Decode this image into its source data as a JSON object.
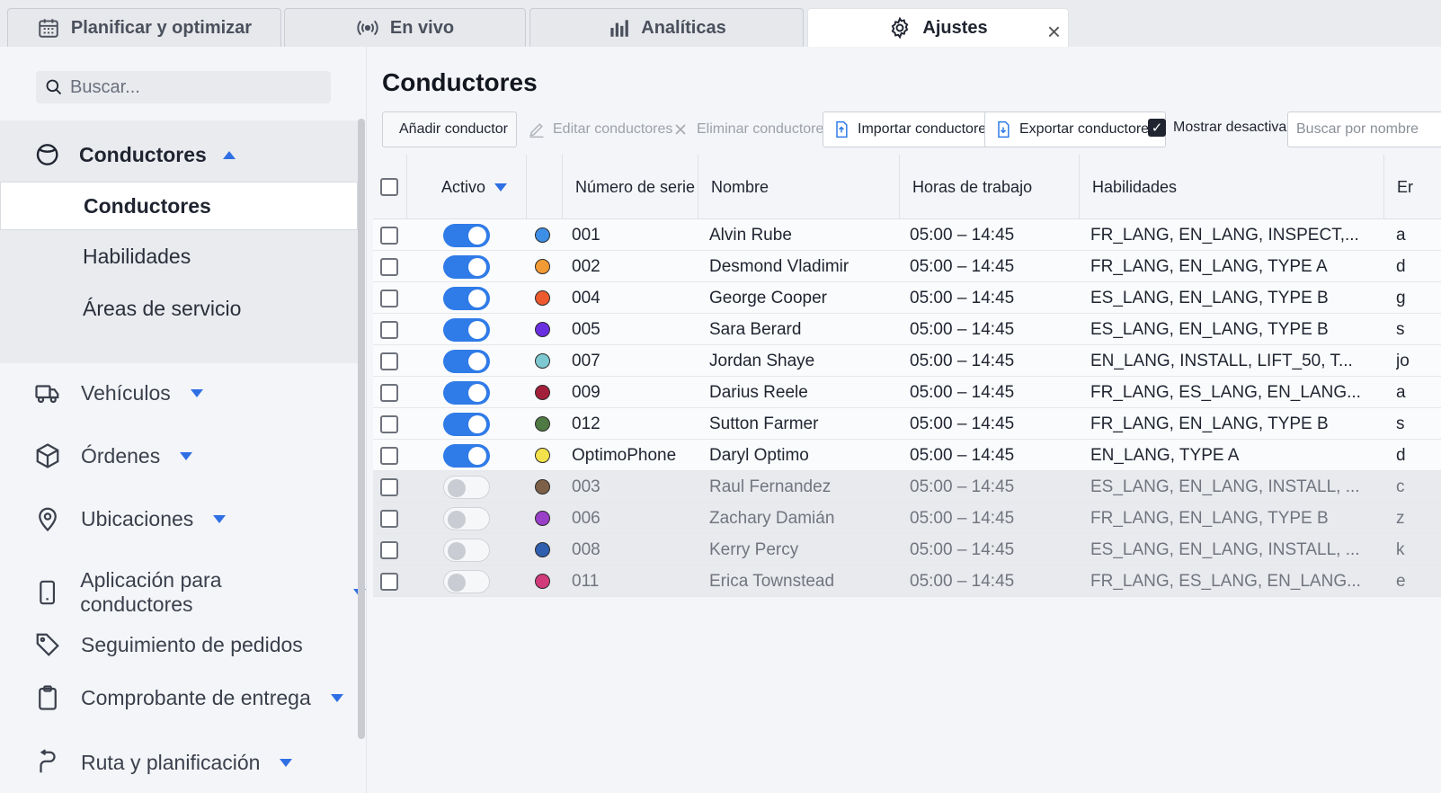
{
  "tabs": [
    {
      "label": "Planificar y optimizar",
      "icon": "calendar-icon"
    },
    {
      "label": "En vivo",
      "icon": "broadcast-icon"
    },
    {
      "label": "Analíticas",
      "icon": "bar-chart-icon"
    },
    {
      "label": "Ajustes",
      "icon": "gear-icon",
      "active": true,
      "close": "×"
    }
  ],
  "sidebar": {
    "search_placeholder": "Buscar...",
    "drivers_header": "Conductores",
    "sub_items": [
      "Conductores",
      "Habilidades",
      "Áreas de servicio"
    ],
    "items": [
      {
        "label": "Vehículos",
        "icon": "truck-icon"
      },
      {
        "label": "Órdenes",
        "icon": "box-icon"
      },
      {
        "label": "Ubicaciones",
        "icon": "location-pin-icon"
      },
      {
        "label": "Aplicación para conductores",
        "icon": "phone-icon"
      },
      {
        "label": "Seguimiento de pedidos",
        "icon": "tag-icon"
      },
      {
        "label": "Comprobante de entrega",
        "icon": "clipboard-icon"
      },
      {
        "label": "Ruta y planificación",
        "icon": "route-icon"
      }
    ]
  },
  "main": {
    "title": "Conductores",
    "toolbar": {
      "add": "Añadir conductor",
      "edit": "Editar conductores",
      "delete": "Eliminar conductores",
      "import": "Importar conductores",
      "export": "Exportar conductores",
      "show_inactive": "Mostrar desactivados",
      "name_search_placeholder": "Buscar por nombre"
    },
    "columns": [
      "Activo",
      "Número de serie",
      "Nombre",
      "Horas de trabajo",
      "Habilidades",
      "Er"
    ],
    "rows": [
      {
        "active": true,
        "color": "#3d8ee6",
        "serial": "001",
        "name": "Alvin Rube",
        "hours": "05:00 – 14:45",
        "skills": "FR_LANG, EN_LANG, INSPECT,...",
        "extra": "a"
      },
      {
        "active": true,
        "color": "#f29a34",
        "serial": "002",
        "name": "Desmond Vladimir",
        "hours": "05:00 – 14:45",
        "skills": "FR_LANG, EN_LANG, TYPE A",
        "extra": "d"
      },
      {
        "active": true,
        "color": "#ec5a2e",
        "serial": "004",
        "name": "George Cooper",
        "hours": "05:00 – 14:45",
        "skills": "ES_LANG, EN_LANG, TYPE B",
        "extra": "g"
      },
      {
        "active": true,
        "color": "#6a2fe0",
        "serial": "005",
        "name": "Sara Berard",
        "hours": "05:00 – 14:45",
        "skills": "ES_LANG, EN_LANG, TYPE B",
        "extra": "s"
      },
      {
        "active": true,
        "color": "#7ec9d1",
        "serial": "007",
        "name": "Jordan Shaye",
        "hours": "05:00 – 14:45",
        "skills": "EN_LANG, INSTALL, LIFT_50, T...",
        "extra": "jo"
      },
      {
        "active": true,
        "color": "#a3203a",
        "serial": "009",
        "name": "Darius Reele",
        "hours": "05:00 – 14:45",
        "skills": "FR_LANG, ES_LANG, EN_LANG...",
        "extra": "a"
      },
      {
        "active": true,
        "color": "#4f7a43",
        "serial": "012",
        "name": "Sutton Farmer",
        "hours": "05:00 – 14:45",
        "skills": "FR_LANG, EN_LANG, TYPE B",
        "extra": "s"
      },
      {
        "active": true,
        "color": "#f2e14a",
        "serial": "OptimoPhone",
        "name": "Daryl Optimo",
        "hours": "05:00 – 14:45",
        "skills": "EN_LANG, TYPE A",
        "extra": "d"
      },
      {
        "active": false,
        "color": "#7d6047",
        "serial": "003",
        "name": "Raul Fernandez",
        "hours": "05:00 – 14:45",
        "skills": "ES_LANG, EN_LANG, INSTALL, ...",
        "extra": "c"
      },
      {
        "active": false,
        "color": "#9a3fc8",
        "serial": "006",
        "name": "Zachary Damián",
        "hours": "05:00 – 14:45",
        "skills": "FR_LANG, EN_LANG, TYPE B",
        "extra": "z"
      },
      {
        "active": false,
        "color": "#2f5fae",
        "serial": "008",
        "name": "Kerry Percy",
        "hours": "05:00 – 14:45",
        "skills": "ES_LANG, EN_LANG, INSTALL, ...",
        "extra": "k"
      },
      {
        "active": false,
        "color": "#d23b7a",
        "serial": "011",
        "name": "Erica Townstead",
        "hours": "05:00 – 14:45",
        "skills": "FR_LANG, ES_LANG, EN_LANG...",
        "extra": "e"
      }
    ]
  },
  "colors": {
    "accent": "#2f7be8",
    "text": "#1f2430"
  }
}
